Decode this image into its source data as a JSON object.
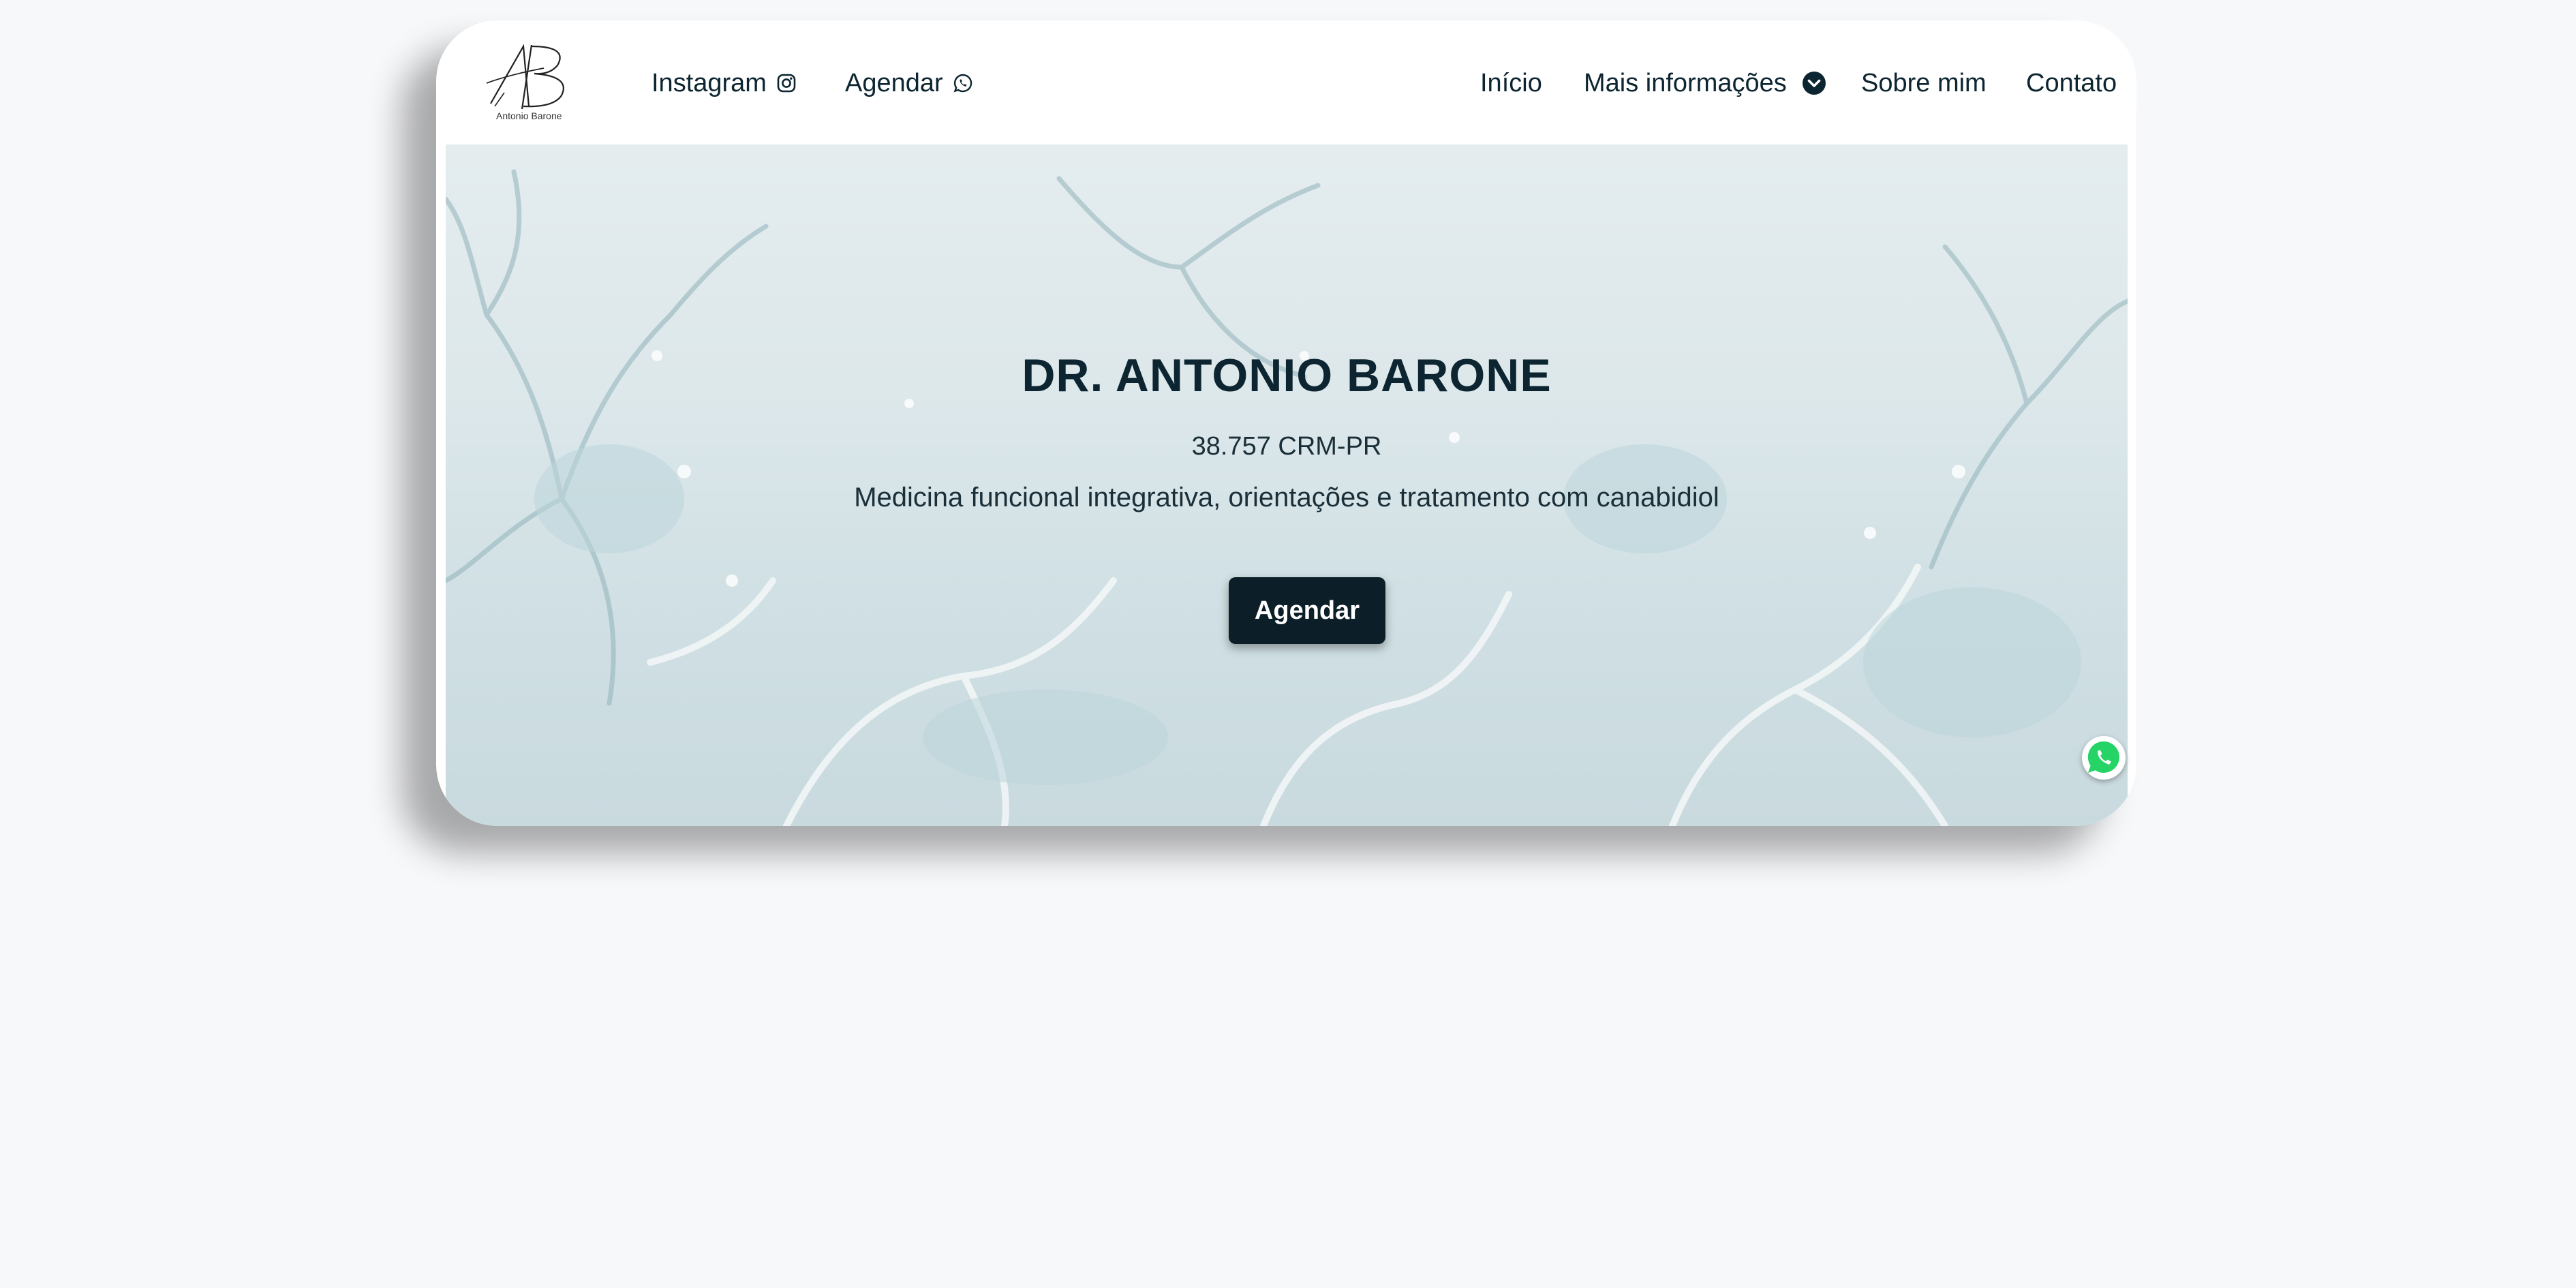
{
  "brand": {
    "logo_text": "Antonio Barone",
    "monogram": "AB"
  },
  "nav": {
    "left": [
      {
        "label": "Instagram",
        "icon": "instagram-icon"
      },
      {
        "label": "Agendar",
        "icon": "whatsapp-icon"
      }
    ],
    "right": [
      {
        "label": "Início"
      },
      {
        "label": "Mais informações",
        "icon": "chevron-down-circle-icon"
      },
      {
        "label": "Sobre mim"
      },
      {
        "label": "Contato"
      }
    ]
  },
  "hero": {
    "title": "DR. ANTONIO BARONE",
    "crm": "38.757 CRM-PR",
    "description": "Medicina funcional integrativa, orientações e tratamento com canabidiol",
    "cta_label": "Agendar",
    "background": "neuron-illustration"
  },
  "floating": {
    "whatsapp_icon": "whatsapp-icon"
  },
  "colors": {
    "text_dark": "#0c2530",
    "button_bg": "#0c1f29",
    "whatsapp_green": "#25d366",
    "page_bg": "#f7f8fa"
  }
}
